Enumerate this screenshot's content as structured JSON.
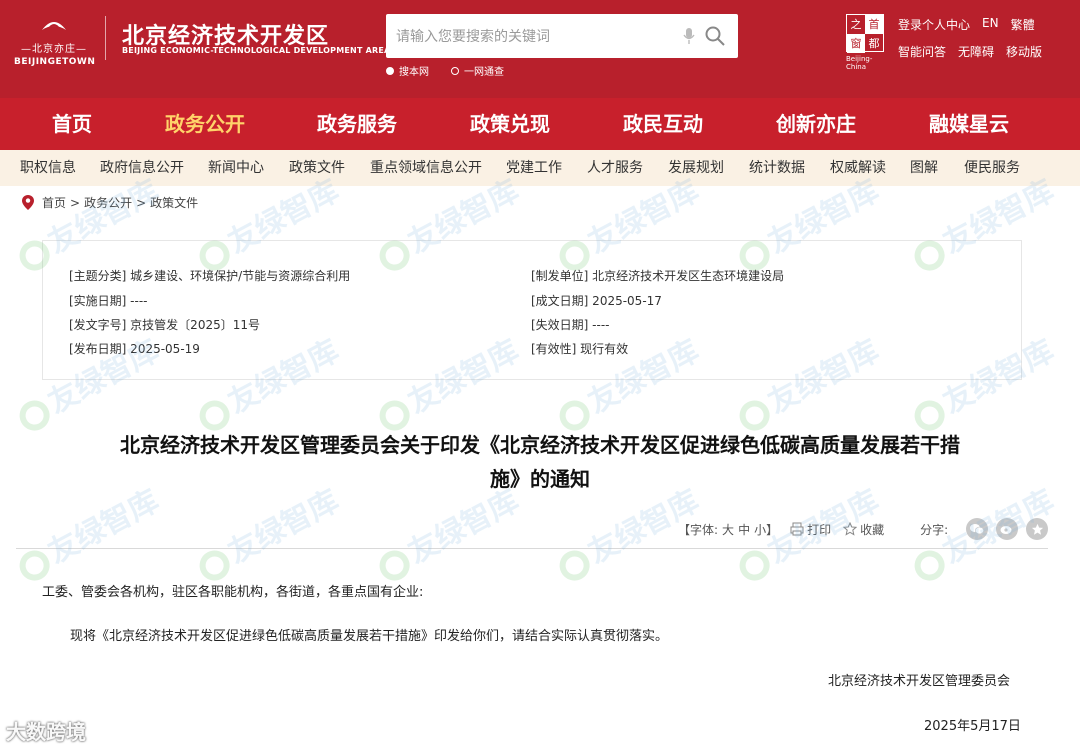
{
  "header": {
    "logo_sub1": "—北京亦庄—",
    "logo_sub2": "BEIJINGETOWN",
    "site_title": "北京经济技术开发区",
    "site_en": "BEIJING ECONOMIC-TECHNOLOGICAL DEVELOPMENT AREA",
    "search_placeholder": "请输入您要搜索的关键词",
    "radio_site": "搜本网",
    "radio_all": "一网通查",
    "badge_chars": [
      "之",
      "首",
      "窗",
      "都"
    ],
    "badge_label": "Beijing-China",
    "tools_row1": [
      "登录个人中心",
      "EN",
      "繁體"
    ],
    "tools_row2": [
      "智能问答",
      "无障碍",
      "移动版"
    ]
  },
  "main_nav": [
    "首页",
    "政务公开",
    "政务服务",
    "政策兑现",
    "政民互动",
    "创新亦庄",
    "融媒星云"
  ],
  "main_nav_active": "政务公开",
  "sub_nav": [
    "职权信息",
    "政府信息公开",
    "新闻中心",
    "政策文件",
    "重点领域信息公开",
    "党建工作",
    "人才服务",
    "发展规划",
    "统计数据",
    "权威解读",
    "图解",
    "便民服务"
  ],
  "breadcrumb": [
    "首页",
    ">",
    "政务公开",
    ">",
    "政策文件"
  ],
  "meta": {
    "topic": "[主题分类] 城乡建设、环境保护/节能与资源综合利用",
    "impl_date": "[实施日期] ----",
    "doc_no": "[发文字号] 京技管发〔2025〕11号",
    "pub_date": "[发布日期] 2025-05-19",
    "issuer": "[制发单位] 北京经济技术开发区生态环境建设局",
    "made_date": "[成文日期] 2025-05-17",
    "expire_date": "[失效日期] ----",
    "validity": "[有效性] 现行有效"
  },
  "title_line1": "北京经济技术开发区管理委员会关于印发《北京经济技术开发区促进绿色低碳高质量发展若干措",
  "title_line2": "施》的通知",
  "toolbar": {
    "font_label": "【字体:",
    "font_large": "大",
    "font_mid": "中",
    "font_small": "小】",
    "print": "打印",
    "favorite": "收藏",
    "share": "分字:"
  },
  "body": {
    "greeting": "工委、管委会各机构，驻区各职能机构，各街道，各重点国有企业:",
    "para1": "现将《北京经济技术开发区促进绿色低碳高质量发展若干措施》印发给你们，请结合实际认真贯彻落实。",
    "signature": "北京经济技术开发区管理委员会",
    "date": "2025年5月17日"
  },
  "watermark_text": "友绿智库",
  "corner_watermark": "大数跨境",
  "colors": {
    "brand_red": "#b8202c",
    "nav_red": "#c8202c",
    "active_nav": "#ffd36a",
    "subnav_bg": "#faf1e4"
  }
}
